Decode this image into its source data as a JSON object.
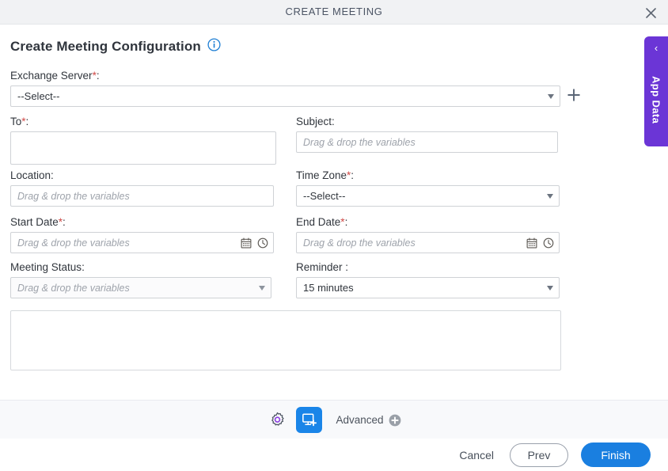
{
  "window": {
    "title": "CREATE MEETING",
    "close_icon": "close-icon"
  },
  "heading": {
    "title": "Create Meeting Configuration",
    "info_icon": "info-icon"
  },
  "side_tab": {
    "label": "App Data",
    "chevron": "‹"
  },
  "fields": {
    "exchange_server": {
      "label": "Exchange Server",
      "required": "*",
      "colon": ":",
      "value": "--Select--",
      "add_icon": "plus-icon"
    },
    "to": {
      "label": "To",
      "required": "*",
      "colon": ":",
      "value": ""
    },
    "subject": {
      "label": "Subject",
      "required": "",
      "colon": ":",
      "placeholder": "Drag & drop the variables"
    },
    "location": {
      "label": "Location",
      "required": "",
      "colon": ":",
      "placeholder": "Drag & drop the variables"
    },
    "time_zone": {
      "label": "Time Zone",
      "required": "*",
      "colon": ":",
      "value": "--Select--"
    },
    "start_date": {
      "label": "Start Date",
      "required": "*",
      "colon": ":",
      "placeholder": "Drag & drop the variables",
      "calendar_icon": "calendar-icon",
      "clock_icon": "clock-icon"
    },
    "end_date": {
      "label": "End Date",
      "required": "*",
      "colon": ":",
      "placeholder": "Drag & drop the variables",
      "calendar_icon": "calendar-icon",
      "clock_icon": "clock-icon"
    },
    "meeting_status": {
      "label": "Meeting Status",
      "required": "",
      "colon": ":",
      "placeholder": "Drag & drop the variables"
    },
    "reminder": {
      "label": "Reminder ",
      "required": "",
      "colon": ":",
      "value": "15 minutes"
    },
    "body": {
      "value": ""
    }
  },
  "toolbar": {
    "settings_icon": "gear-icon",
    "screen_icon": "screen-add-icon",
    "advanced_label": "Advanced",
    "advanced_add_icon": "circle-plus-icon"
  },
  "actions": {
    "cancel": "Cancel",
    "prev": "Prev",
    "finish": "Finish"
  },
  "colors": {
    "primary": "#1a7fe0",
    "toolbar_active": "#1a85e8",
    "app_data": "#6b35d6",
    "required": "#d04a47",
    "titlebar": "#f1f2f4"
  }
}
